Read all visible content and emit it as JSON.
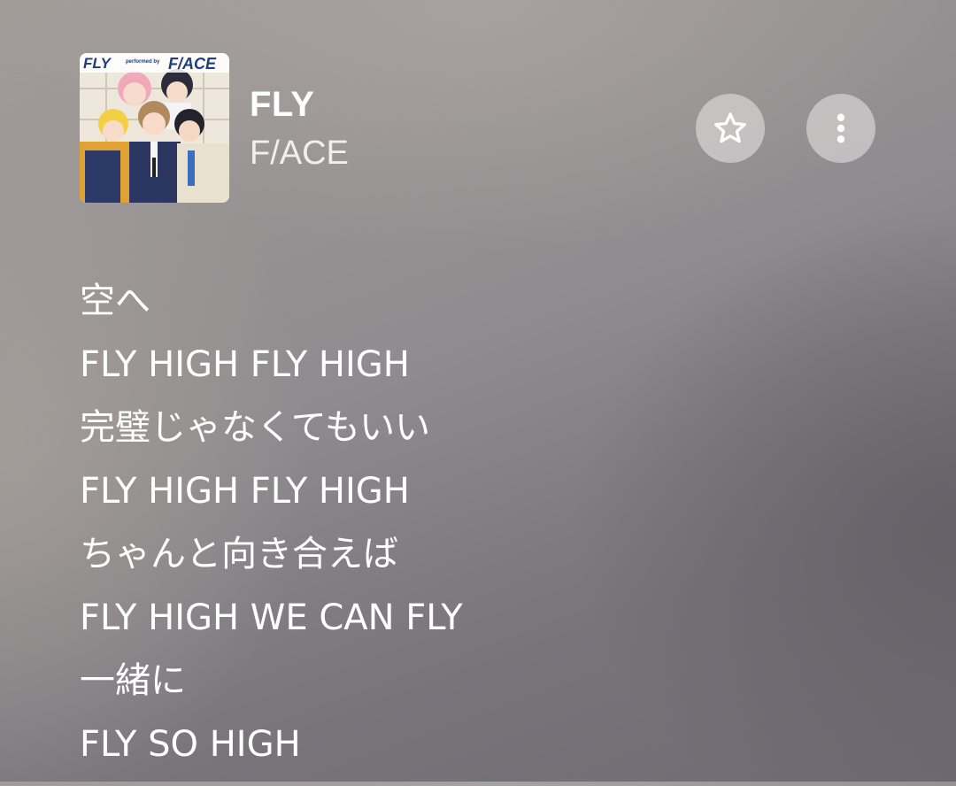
{
  "track": {
    "title": "FLY",
    "artist": "F/ACE",
    "album_art": {
      "label_left": "FLY",
      "label_small": "performed by",
      "label_right": "F/ACE"
    }
  },
  "actions": {
    "favorite_icon": "star-outline-icon",
    "more_icon": "more-vertical-icon"
  },
  "lyrics": [
    "空へ",
    "FLY HIGH FLY HIGH",
    "完璧じゃなくてもいい",
    "FLY HIGH FLY HIGH",
    "ちゃんと向き合えば",
    "FLY HIGH WE CAN FLY",
    "一緒に",
    "FLY SO HIGH"
  ],
  "colors": {
    "text": "#ffffff",
    "button_bg": "#d9d6d6"
  }
}
